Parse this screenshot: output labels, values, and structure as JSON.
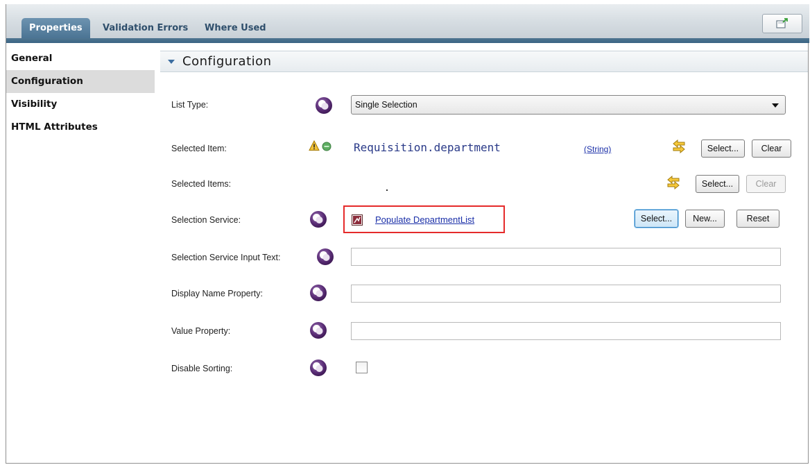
{
  "tabs": [
    {
      "label": "Properties"
    },
    {
      "label": "Validation Errors"
    },
    {
      "label": "Where Used"
    }
  ],
  "sidebar": {
    "items": [
      {
        "label": "General"
      },
      {
        "label": "Configuration"
      },
      {
        "label": "Visibility"
      },
      {
        "label": "HTML Attributes"
      }
    ],
    "selected": "Configuration"
  },
  "section": {
    "title": "Configuration"
  },
  "fields": {
    "list_type": {
      "label": "List Type:",
      "value": "Single Selection"
    },
    "selected_item": {
      "label": "Selected Item:",
      "binding": "Requisition.department",
      "type_link": "(String)"
    },
    "selected_items": {
      "label": "Selected Items:"
    },
    "selection_service": {
      "label": "Selection Service:",
      "service_link": "Populate DepartmentList"
    },
    "service_input_text": {
      "label": "Selection Service Input Text:",
      "value": ""
    },
    "display_name_property": {
      "label": "Display Name Property:",
      "value": ""
    },
    "value_property": {
      "label": "Value Property:",
      "value": ""
    },
    "disable_sorting": {
      "label": "Disable Sorting:",
      "checked": false
    }
  },
  "buttons": {
    "select": "Select...",
    "clear": "Clear",
    "new": "New...",
    "reset": "Reset"
  },
  "icons": {
    "variable_orb": "purple-orb-icon",
    "warning": "warning-icon",
    "status": "green-status-icon",
    "swap": "swap-arrows-icon",
    "service": "service-icon",
    "dropdown": "chevron-down-icon",
    "collapse": "triangle-down-icon",
    "maximize": "maximize-icon"
  },
  "colors": {
    "tab_active": "#5a82a1",
    "link": "#1a2fa8",
    "highlight_box": "#e52a2a",
    "orb": "#5b2e77"
  }
}
